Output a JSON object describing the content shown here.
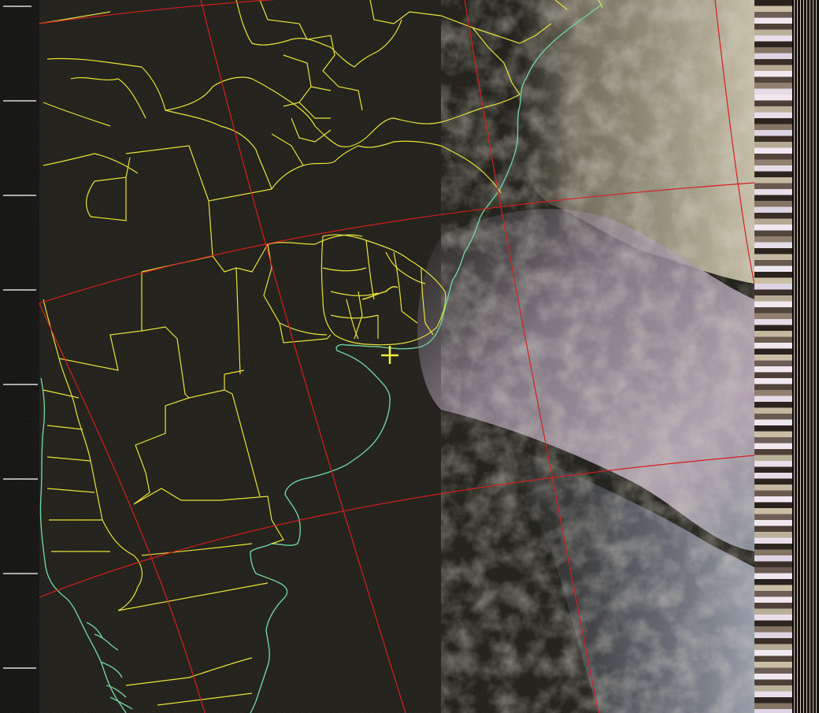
{
  "map": {
    "image_type": "satellite-weather-image",
    "colors": {
      "background": "#000000",
      "land_dark": "#14130e",
      "cloud_light": "#cfc8b4",
      "cloud_pink": "#b7a6bd",
      "cloud_blue": "#9aa4b6",
      "political_boundaries": "#e8e23a",
      "coastlines": "#6ed39a",
      "graticule": "#d42020",
      "target_marker": "#f4f03a",
      "telemetry_dark": "#1a1410",
      "telemetry_light": "#efe9ef"
    },
    "marker": {
      "icon": "crosshair-plus-icon"
    },
    "telemetry_strip": {
      "blocks": [
        "#2a221e",
        "#cabfa4",
        "#6e5e58",
        "#efe6ee",
        "#4e4038",
        "#b9b09a",
        "#e9dde9",
        "#2d2620",
        "#847464",
        "#dcd4e2",
        "#3a3028",
        "#b4aa94",
        "#f0e8f0",
        "#51453c",
        "#918070",
        "#e4dce6",
        "#2c241e",
        "#c3b8a0",
        "#6a5a50",
        "#ede6ef"
      ]
    }
  }
}
